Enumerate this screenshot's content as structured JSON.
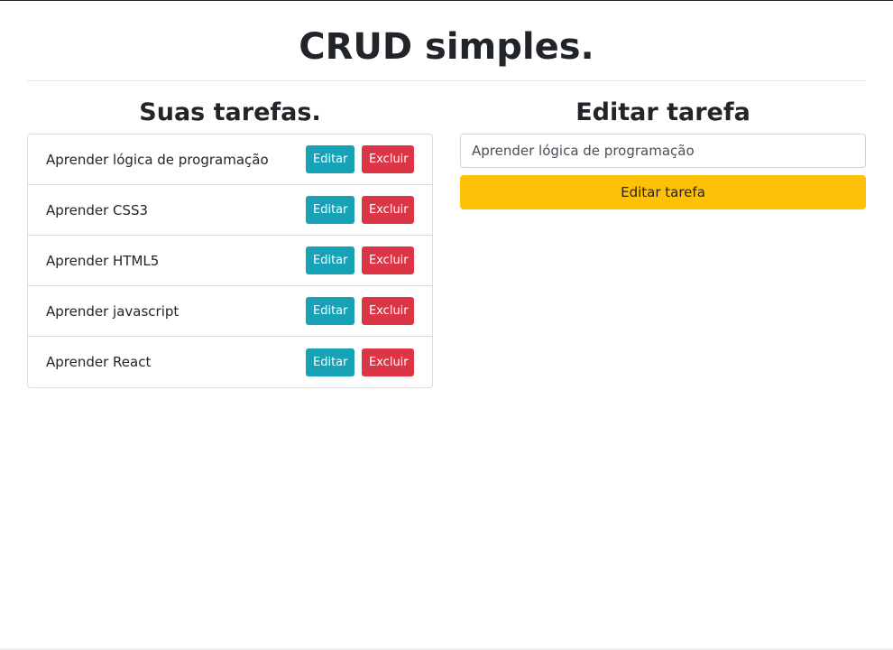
{
  "page": {
    "title": "CRUD simples."
  },
  "tasks_section": {
    "title": "Suas tarefas.",
    "edit_label": "Editar",
    "delete_label": "Excluir",
    "items": [
      {
        "label": "Aprender lógica de programação"
      },
      {
        "label": "Aprender CSS3"
      },
      {
        "label": "Aprender HTML5"
      },
      {
        "label": "Aprender javascript"
      },
      {
        "label": "Aprender React"
      }
    ]
  },
  "edit_section": {
    "title": "Editar tarefa",
    "input_value": "Aprender lógica de programação",
    "submit_label": "Editar tarefa"
  },
  "colors": {
    "edit_button": "#17a2b8",
    "delete_button": "#dc3545",
    "submit_button": "#ffc107"
  }
}
